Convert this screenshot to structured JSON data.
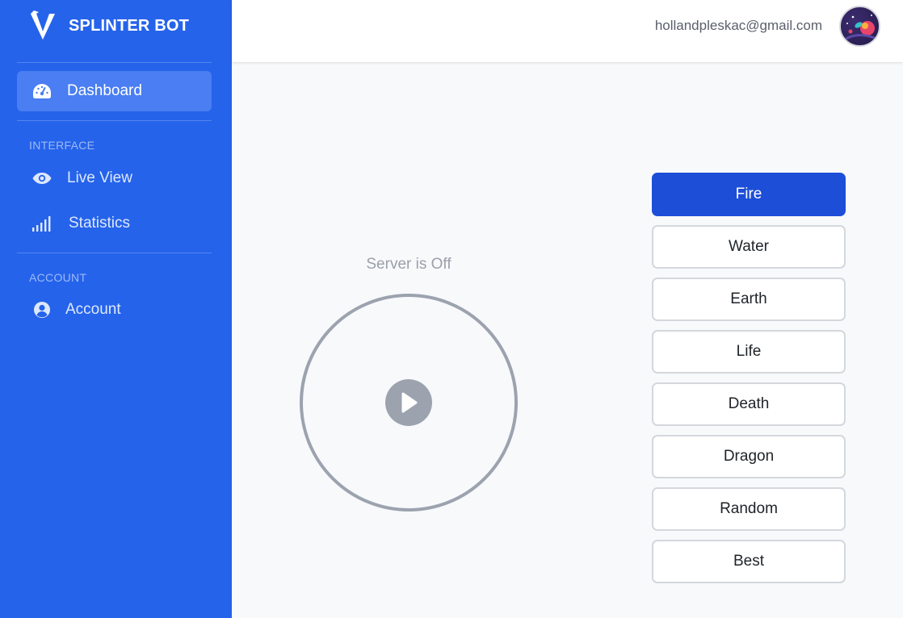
{
  "brand": {
    "name": "SPLINTER BOT"
  },
  "sidebar": {
    "dashboard": {
      "label": "Dashboard",
      "icon": "speedometer-icon"
    },
    "interface_heading": "INTERFACE",
    "live_view": {
      "label": "Live View",
      "icon": "eye-icon"
    },
    "statistics": {
      "label": "Statistics",
      "icon": "signal-bars-icon"
    },
    "account_heading": "ACCOUNT",
    "account": {
      "label": "Account",
      "icon": "user-circle-icon"
    }
  },
  "topbar": {
    "email": "hollandpleskac@gmail.com"
  },
  "main": {
    "server_status": "Server is Off",
    "elements": [
      {
        "label": "Fire",
        "selected": true
      },
      {
        "label": "Water",
        "selected": false
      },
      {
        "label": "Earth",
        "selected": false
      },
      {
        "label": "Life",
        "selected": false
      },
      {
        "label": "Death",
        "selected": false
      },
      {
        "label": "Dragon",
        "selected": false
      },
      {
        "label": "Random",
        "selected": false
      },
      {
        "label": "Best",
        "selected": false
      }
    ]
  },
  "colors": {
    "sidebar": "#2563eb",
    "selected_button": "#1d4ed8",
    "ring": "#9ca3af"
  }
}
